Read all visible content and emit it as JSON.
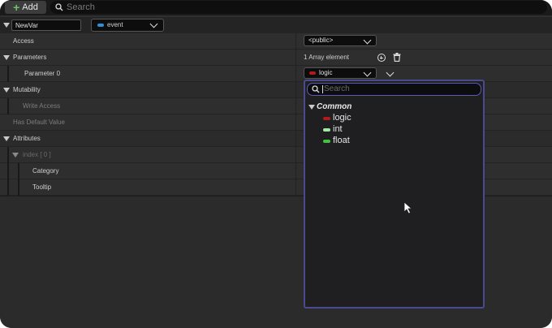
{
  "toolbar": {
    "add_label": "Add",
    "search_placeholder": "Search"
  },
  "variable": {
    "name": "NewVar",
    "type": "event",
    "type_color": "#2f8fd0"
  },
  "rows": {
    "access": {
      "label": "Access",
      "value": "<public>"
    },
    "parameters": {
      "label": "Parameters",
      "value": "1 Array element"
    },
    "parameter0": {
      "label": "Parameter 0",
      "value": "logic",
      "value_color": "#b01b1b"
    },
    "mutability": {
      "label": "Mutability"
    },
    "write_access": {
      "label": "Write Access"
    },
    "has_default": {
      "label": "Has Default Value"
    },
    "attributes": {
      "label": "Attributes"
    },
    "index": {
      "label": "index [ 0 ]"
    },
    "category": {
      "label": "Category"
    },
    "tooltip": {
      "label": "Tooltip"
    }
  },
  "popup": {
    "search_placeholder": "Search",
    "category": "Common",
    "items": [
      {
        "label": "logic",
        "color": "#b01b1b"
      },
      {
        "label": "int",
        "color": "#a6e6a6"
      },
      {
        "label": "float",
        "color": "#3ec43e"
      }
    ]
  }
}
